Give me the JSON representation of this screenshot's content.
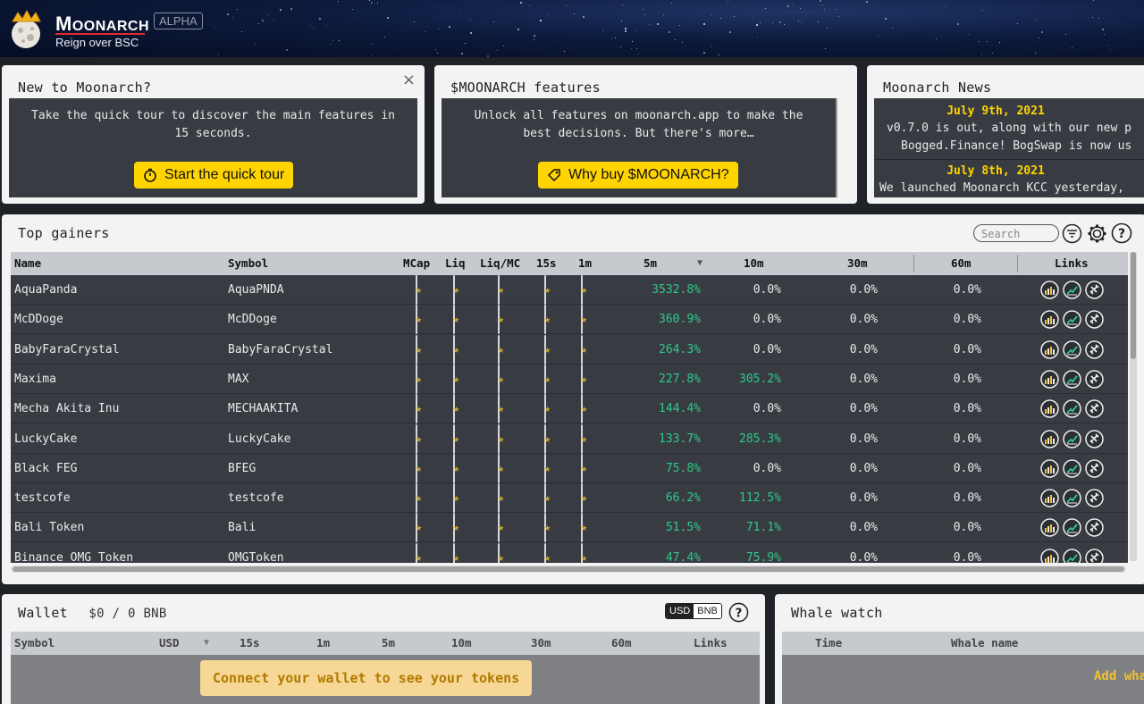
{
  "header": {
    "brand": "Moonarch",
    "badge": "ALPHA",
    "tagline": "Reign over BSC"
  },
  "intro_panel": {
    "title": "New to Moonarch?",
    "close": "×",
    "text": "Take the quick tour to discover the main features in 15 seconds.",
    "button": "Start the quick tour"
  },
  "features_panel": {
    "title": "$MOONARCH features",
    "text": "Unlock all features on moonarch.app to make the best decisions. But there's more…",
    "button": "Why buy $MOONARCH?"
  },
  "news_panel": {
    "title": "Moonarch News",
    "items": [
      {
        "date": "July 9th, 2021",
        "lines": [
          "v0.7.0 is out, along with our new p",
          "Bogged.Finance! BogSwap is now us"
        ]
      },
      {
        "date": "July 8th, 2021",
        "lines": [
          "We launched Moonarch KCC yesterday,"
        ]
      }
    ]
  },
  "gainers": {
    "title": "Top gainers",
    "search_placeholder": "Search",
    "columns": [
      "Name",
      "Symbol",
      "MCap",
      "Liq",
      "Liq/MC",
      "15s",
      "1m",
      "5m",
      "10m",
      "30m",
      "60m",
      "Links"
    ],
    "sort_icon": "▼",
    "star": "★",
    "rows": [
      {
        "name": "AquaPanda",
        "symbol": "AquaPNDA",
        "m5": "3532.8%",
        "m10": "0.0%",
        "m30": "0.0%",
        "m60": "0.0%"
      },
      {
        "name": "McDDoge",
        "symbol": "McDDoge",
        "m5": "360.9%",
        "m10": "0.0%",
        "m30": "0.0%",
        "m60": "0.0%"
      },
      {
        "name": "BabyFaraCrystal",
        "symbol": "BabyFaraCrystal",
        "m5": "264.3%",
        "m10": "0.0%",
        "m30": "0.0%",
        "m60": "0.0%"
      },
      {
        "name": "Maxima",
        "symbol": "MAX",
        "m5": "227.8%",
        "m10": "305.2%",
        "m30": "0.0%",
        "m60": "0.0%"
      },
      {
        "name": "Mecha Akita Inu",
        "symbol": "MECHAAKITA",
        "m5": "144.4%",
        "m10": "0.0%",
        "m30": "0.0%",
        "m60": "0.0%"
      },
      {
        "name": "LuckyCake",
        "symbol": "LuckyCake",
        "m5": "133.7%",
        "m10": "285.3%",
        "m30": "0.0%",
        "m60": "0.0%"
      },
      {
        "name": "Black FEG",
        "symbol": "BFEG",
        "m5": "75.8%",
        "m10": "0.0%",
        "m30": "0.0%",
        "m60": "0.0%"
      },
      {
        "name": "testcofe",
        "symbol": "testcofe",
        "m5": "66.2%",
        "m10": "112.5%",
        "m30": "0.0%",
        "m60": "0.0%"
      },
      {
        "name": "Bali Token",
        "symbol": "Bali",
        "m5": "51.5%",
        "m10": "71.1%",
        "m30": "0.0%",
        "m60": "0.0%"
      },
      {
        "name": "Binance OMG Token",
        "symbol": "OMGToken",
        "m5": "47.4%",
        "m10": "75.9%",
        "m30": "0.0%",
        "m60": "0.0%"
      }
    ]
  },
  "wallet": {
    "title": "Wallet",
    "balance": "$0 / 0 BNB",
    "toggle_on": "USD",
    "toggle_off": "BNB",
    "help": "?",
    "columns": [
      "Symbol",
      "USD",
      "15s",
      "1m",
      "5m",
      "10m",
      "30m",
      "60m",
      "Links"
    ],
    "connect": "Connect your wallet to see your tokens"
  },
  "whale": {
    "title": "Whale watch",
    "columns": [
      "Time",
      "Whale name"
    ],
    "add": "Add wha"
  },
  "colors": {
    "accent_yellow": "#ffd400",
    "gain_green": "#2fc88a",
    "panel_dark": "#383c42"
  }
}
